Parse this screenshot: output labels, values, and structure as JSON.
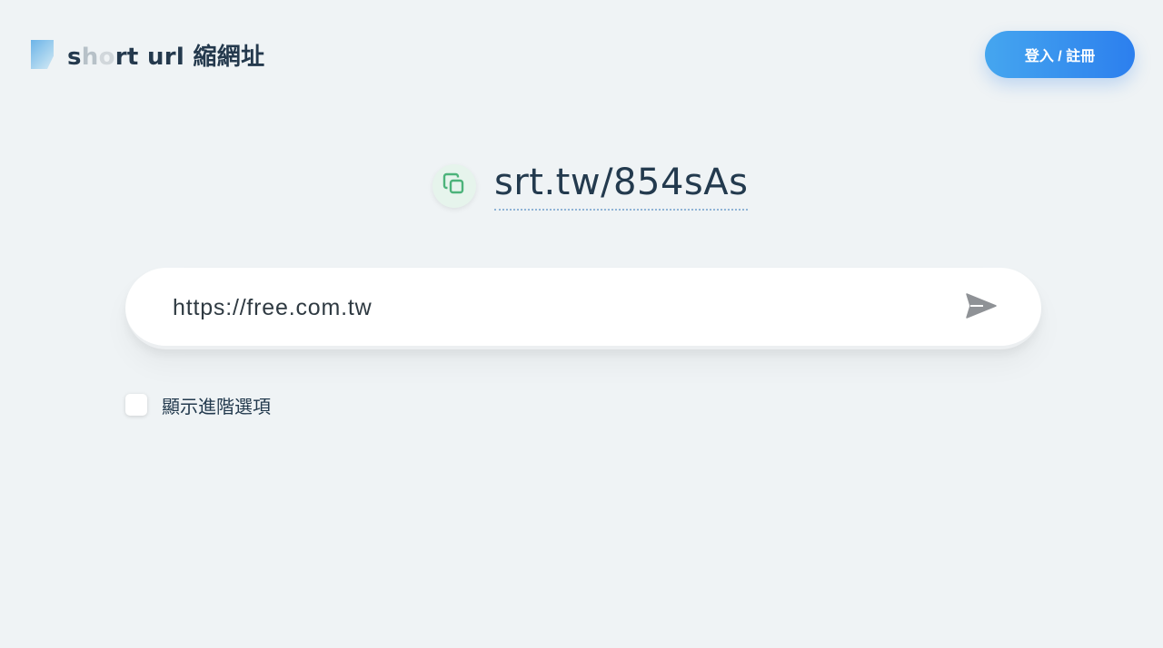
{
  "header": {
    "logo_text_s": "s",
    "logo_text_h": "h",
    "logo_text_o": "o",
    "logo_text_rest": "rt url 縮網址",
    "login_label": "登入 / 註冊"
  },
  "result": {
    "short_url": "srt.tw/854sAs",
    "copy_icon": "copy-icon"
  },
  "form": {
    "url_value": "https://free.com.tw",
    "send_icon": "send-icon",
    "advanced_label": "顯示進階選項",
    "advanced_checked": false
  },
  "colors": {
    "background": "#eff3f5",
    "accent_start": "#45a6ef",
    "accent_end": "#2c7fee",
    "copy_green": "#4cb37a",
    "text_dark": "#233a4e"
  }
}
